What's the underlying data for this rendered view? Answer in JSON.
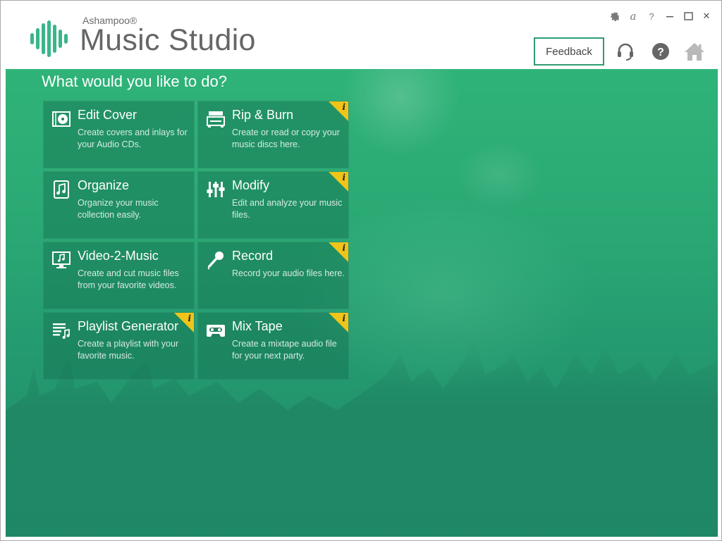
{
  "app": {
    "brand_small": "Ashampoo®",
    "brand_title": "Music Studio"
  },
  "titlebar": {
    "icons": [
      "gear-icon",
      "language-icon",
      "help-question-icon",
      "minimize-icon",
      "maximize-icon",
      "close-icon"
    ],
    "language_glyph": "a",
    "help_glyph": "?",
    "close_glyph": "✕"
  },
  "header": {
    "feedback_label": "Feedback",
    "icons": [
      "headset-icon",
      "help-circle-icon",
      "home-icon"
    ],
    "help_glyph": "?"
  },
  "main": {
    "question": "What would you like to do?",
    "tiles": [
      {
        "title": "Edit Cover",
        "description": "Create covers and inlays for your Audio CDs.",
        "icon": "cd-case-icon",
        "info": false
      },
      {
        "title": "Rip & Burn",
        "description": "Create or read or copy your music discs here.",
        "icon": "disc-drive-icon",
        "info": true
      },
      {
        "title": "Organize",
        "description": "Organize your music collection easily.",
        "icon": "music-note-icon",
        "info": false
      },
      {
        "title": "Modify",
        "description": "Edit and analyze your music files.",
        "icon": "equalizer-sliders-icon",
        "info": true
      },
      {
        "title": "Video-2-Music",
        "description": "Create and cut music files from your favorite videos.",
        "icon": "monitor-music-icon",
        "info": false
      },
      {
        "title": "Record",
        "description": "Record your audio files here.",
        "icon": "microphone-icon",
        "info": true
      },
      {
        "title": "Playlist Generator",
        "description": "Create a playlist with your favorite music.",
        "icon": "playlist-icon",
        "info": true
      },
      {
        "title": "Mix Tape",
        "description": "Create a mixtape audio file for your next party.",
        "icon": "cassette-icon",
        "info": true
      }
    ],
    "info_glyph": "i"
  },
  "colors": {
    "accent": "#2e9c74",
    "info_flag": "#f0c419",
    "logo": "#3bb58a"
  }
}
